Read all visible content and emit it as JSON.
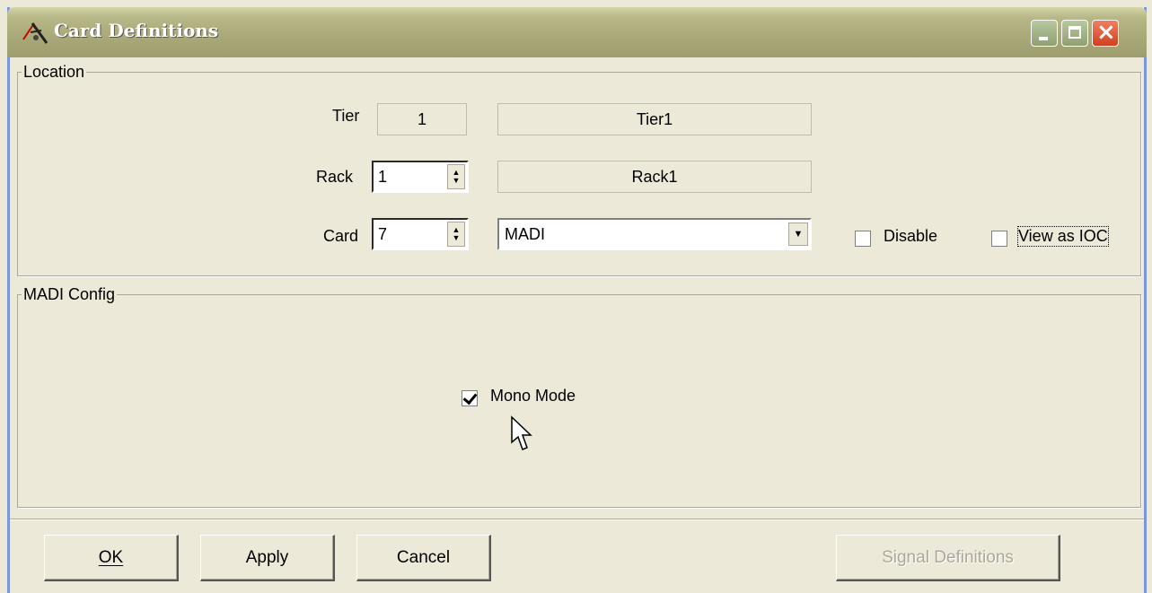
{
  "window": {
    "title": "Card Definitions"
  },
  "location": {
    "group_title": "Location",
    "tier_label": "Tier",
    "tier_value": "1",
    "tier_name": "Tier1",
    "rack_label": "Rack",
    "rack_value": "1",
    "rack_name": "Rack1",
    "card_label": "Card",
    "card_value": "7",
    "card_type": "MADI",
    "disable_label": "Disable",
    "view_as_ioc_label": "View as IOC"
  },
  "madi_config": {
    "group_title": "MADI Config",
    "mono_mode_label": "Mono Mode",
    "mono_mode_checked": true
  },
  "buttons": {
    "ok": "OK",
    "apply": "Apply",
    "cancel": "Cancel",
    "signal_definitions": "Signal Definitions"
  }
}
